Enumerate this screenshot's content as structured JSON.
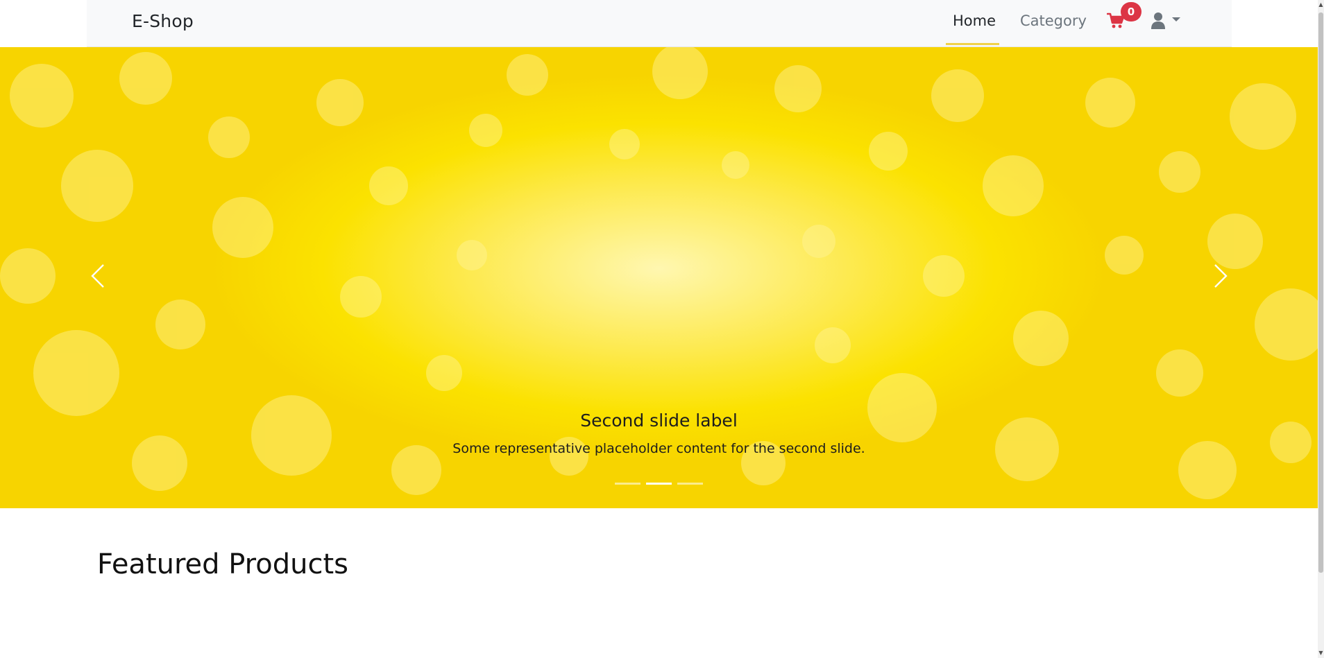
{
  "navbar": {
    "brand": "E-Shop",
    "links": [
      {
        "label": "Home",
        "active": true
      },
      {
        "label": "Category",
        "active": false
      }
    ],
    "cart": {
      "icon": "cart-icon",
      "count": "0",
      "badge_color": "#dc3545",
      "icon_color": "#dc3545"
    },
    "user": {
      "icon": "user-icon",
      "caret": "caret-down-icon",
      "color": "#6c757d"
    },
    "active_underline_color": "#f0d24a"
  },
  "carousel": {
    "caption_title": "Second slide label",
    "caption_text": "Some representative placeholder content for the second slide.",
    "indicators": [
      {
        "active": false
      },
      {
        "active": true
      },
      {
        "active": false
      }
    ],
    "active_index": 1,
    "prev_icon": "chevron-left-icon",
    "next_icon": "chevron-right-icon",
    "background_color": "#fbe200"
  },
  "featured": {
    "title": "Featured Products"
  }
}
